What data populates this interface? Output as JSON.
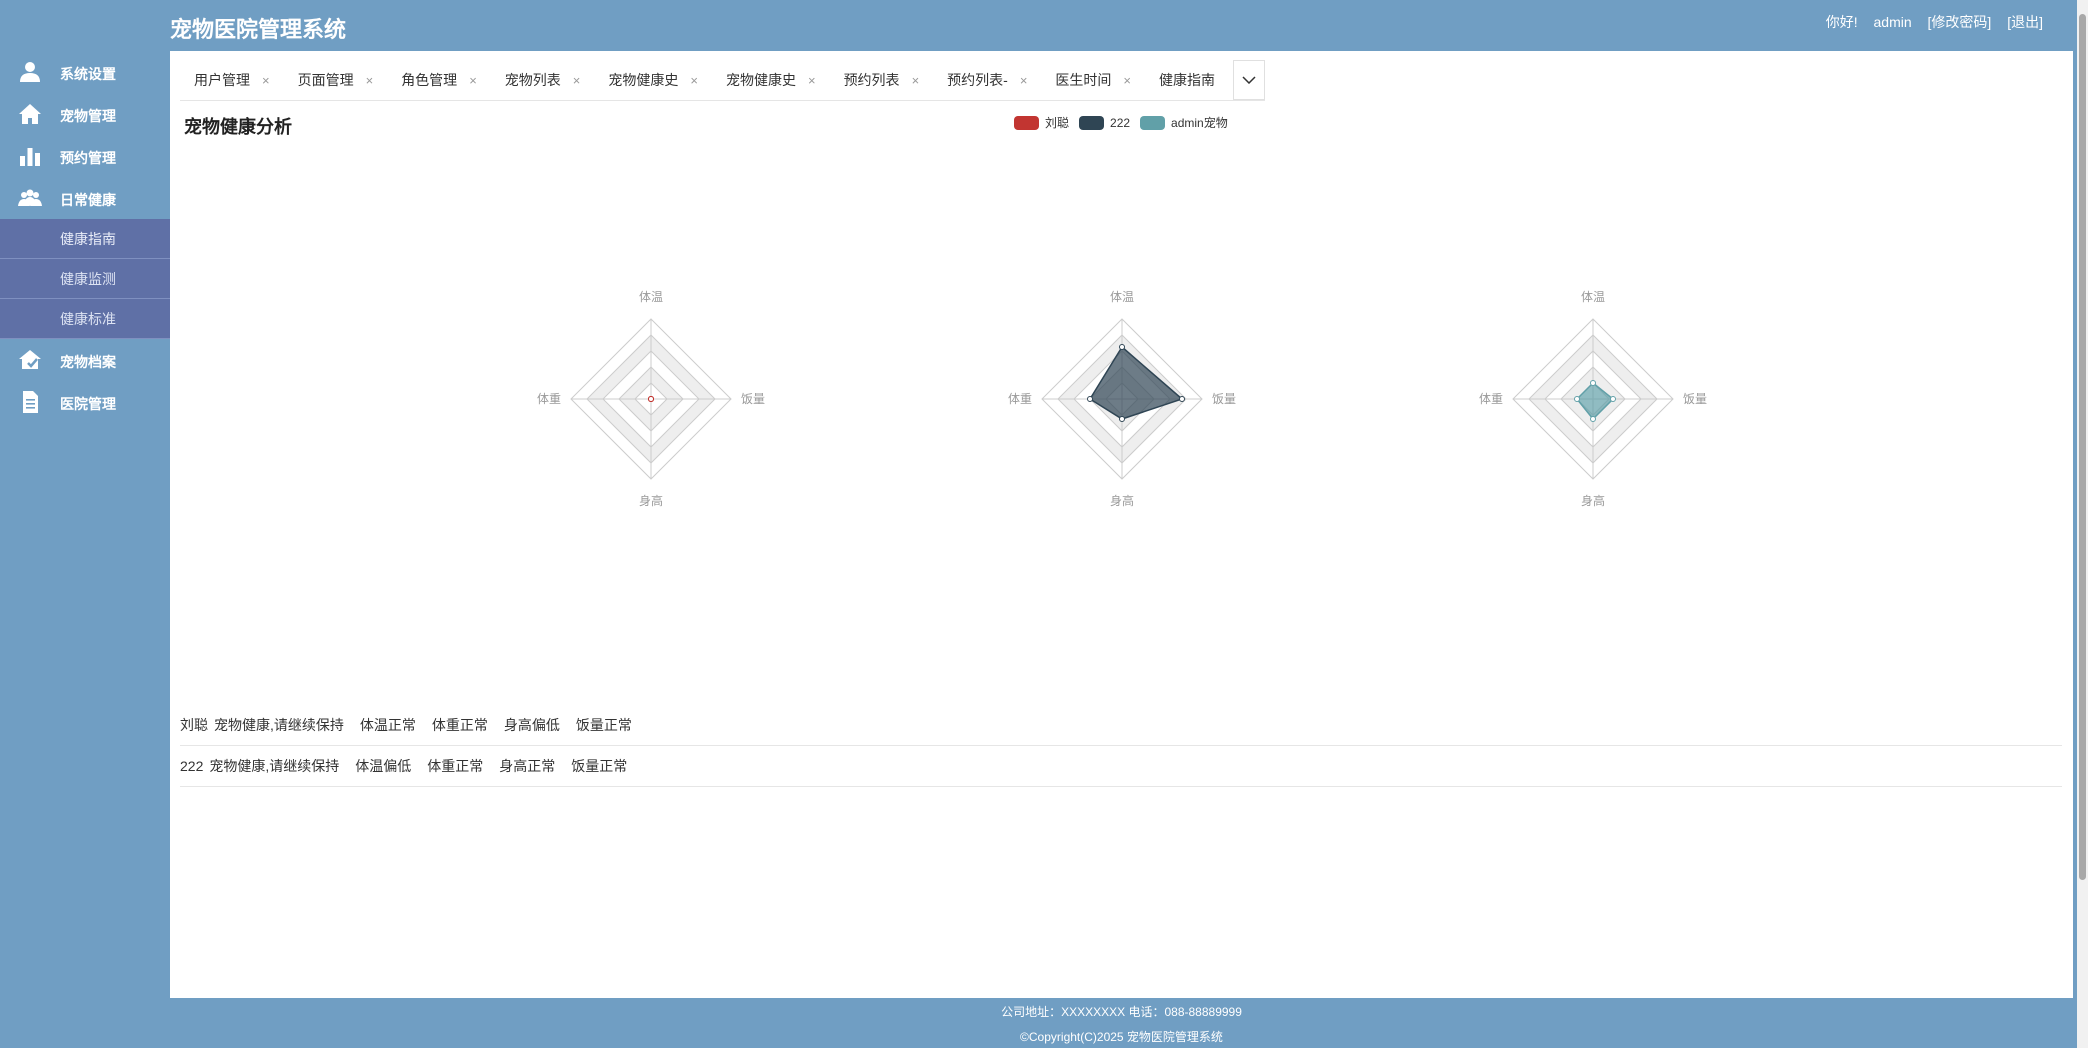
{
  "header": {
    "title": "宠物医院管理系统",
    "greeting": "你好!",
    "username": "admin",
    "change_password": "[修改密码]",
    "logout": "[退出]"
  },
  "sidebar": {
    "items": [
      {
        "label": "系统设置",
        "icon": "user-icon"
      },
      {
        "label": "宠物管理",
        "icon": "home-icon"
      },
      {
        "label": "预约管理",
        "icon": "bar-chart-icon"
      },
      {
        "label": "日常健康",
        "icon": "group-icon"
      },
      {
        "label": "宠物档案",
        "icon": "pet-record-icon"
      },
      {
        "label": "医院管理",
        "icon": "document-icon"
      }
    ],
    "subitems": [
      {
        "label": "健康指南"
      },
      {
        "label": "健康监测"
      },
      {
        "label": "健康标准"
      }
    ]
  },
  "tabs": [
    {
      "label": "用户管理"
    },
    {
      "label": "页面管理"
    },
    {
      "label": "角色管理"
    },
    {
      "label": "宠物列表"
    },
    {
      "label": "宠物健康史"
    },
    {
      "label": "宠物健康史"
    },
    {
      "label": "预约列表"
    },
    {
      "label": "预约列表-"
    },
    {
      "label": "医生时间"
    },
    {
      "label": "健康指南"
    }
  ],
  "tab_close_glyph": "×",
  "page_title": "宠物健康分析",
  "chart_data": {
    "type": "radar",
    "indicators": [
      "体温",
      "饭量",
      "身高",
      "体重"
    ],
    "max": 100,
    "split_number": 5,
    "legend": [
      {
        "name": "刘聪",
        "color": "#c23531"
      },
      {
        "name": "222",
        "color": "#2f4554"
      },
      {
        "name": "admin宠物",
        "color": "#61a0a8"
      }
    ],
    "series": [
      {
        "name": "刘聪",
        "values": [
          0,
          0,
          0,
          0
        ]
      },
      {
        "name": "222",
        "values": [
          65,
          75,
          25,
          40
        ]
      },
      {
        "name": "admin宠物",
        "values": [
          20,
          25,
          25,
          20
        ]
      }
    ]
  },
  "summaries": [
    {
      "name": "刘聪",
      "status": "宠物健康,请继续保持",
      "temp": "体温正常",
      "weight": "体重正常",
      "height": "身高偏低",
      "food": "饭量正常"
    },
    {
      "name": "222",
      "status": "宠物健康,请继续保持",
      "temp": "体温偏低",
      "weight": "体重正常",
      "height": "身高正常",
      "food": "饭量正常"
    }
  ],
  "footer": {
    "address": "公司地址：XXXXXXXX 电话：088-88889999",
    "copyright": "©Copyright(C)2025 宠物医院管理系统"
  }
}
